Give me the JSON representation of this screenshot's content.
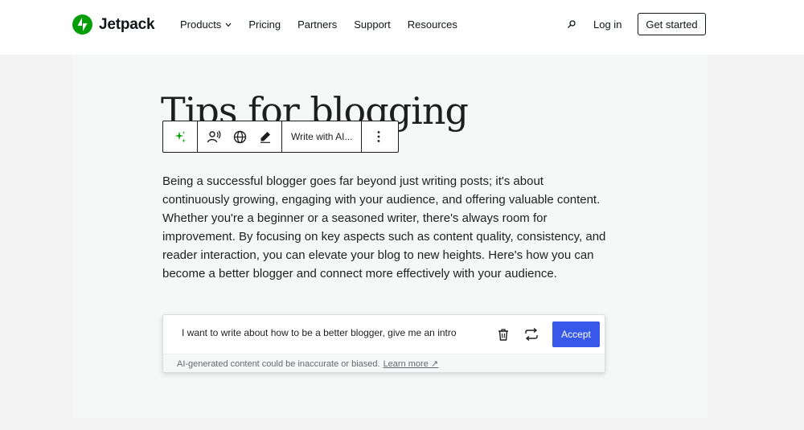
{
  "header": {
    "brand": "Jetpack",
    "nav": [
      "Products",
      "Pricing",
      "Partners",
      "Support",
      "Resources"
    ],
    "login_label": "Log in",
    "cta_label": "Get started",
    "brand_color": "#069e08"
  },
  "editor": {
    "title": "Tips for blogging",
    "toolbar": {
      "write_label": "Write with AI...",
      "icons": [
        "ai-sparkle-icon",
        "voice-icon",
        "globe-icon",
        "pencil-icon",
        "more-vertical-icon"
      ]
    },
    "paragraph": "Being a successful blogger goes far beyond just writing posts; it's about continuously growing, engaging with your audience, and offering valuable content. Whether you're a beginner or a seasoned writer, there's always room for improvement. By focusing on key aspects such as content quality, consistency, and reader interaction, you can elevate your blog to new heights. Here's how you can become a better blogger and connect more effectively with your audience."
  },
  "ai_box": {
    "prompt": "I want to write about how to be a better blogger, give me an intro",
    "accept_label": "Accept",
    "accept_color": "#3858e9",
    "disclaimer": "AI-generated content could be inaccurate or biased.",
    "learn_more": "Learn more ↗"
  }
}
